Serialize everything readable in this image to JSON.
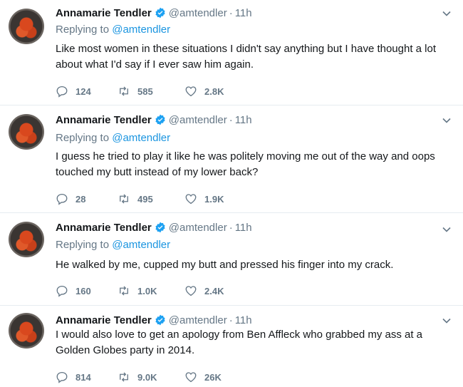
{
  "tweets": [
    {
      "name": "Annamarie Tendler",
      "handle": "@amtendler",
      "time": "11h",
      "reply_prefix": "Replying to",
      "reply_to": "@amtendler",
      "text": "Like most women in these situations I didn't say anything but I have thought a lot about what I'd say if I ever saw him again.",
      "replies": "124",
      "retweets": "585",
      "likes": "2.8K"
    },
    {
      "name": "Annamarie Tendler",
      "handle": "@amtendler",
      "time": "11h",
      "reply_prefix": "Replying to",
      "reply_to": "@amtendler",
      "text": "I guess he tried to play it like he was politely moving me out of the way and oops touched my butt instead of my lower back?",
      "replies": "28",
      "retweets": "495",
      "likes": "1.9K"
    },
    {
      "name": "Annamarie Tendler",
      "handle": "@amtendler",
      "time": "11h",
      "reply_prefix": "Replying to",
      "reply_to": "@amtendler",
      "text": "He walked by me, cupped my butt and pressed his finger into my crack.",
      "replies": "160",
      "retweets": "1.0K",
      "likes": "2.4K"
    },
    {
      "name": "Annamarie Tendler",
      "handle": "@amtendler",
      "time": "11h",
      "text": "I would also love to get an apology from Ben Affleck who grabbed my ass at a Golden Globes party in 2014.",
      "replies": "814",
      "retweets": "9.0K",
      "likes": "26K"
    }
  ],
  "colors": {
    "verified": "#1da1f2",
    "link": "#1b95e0",
    "muted": "#657786"
  }
}
